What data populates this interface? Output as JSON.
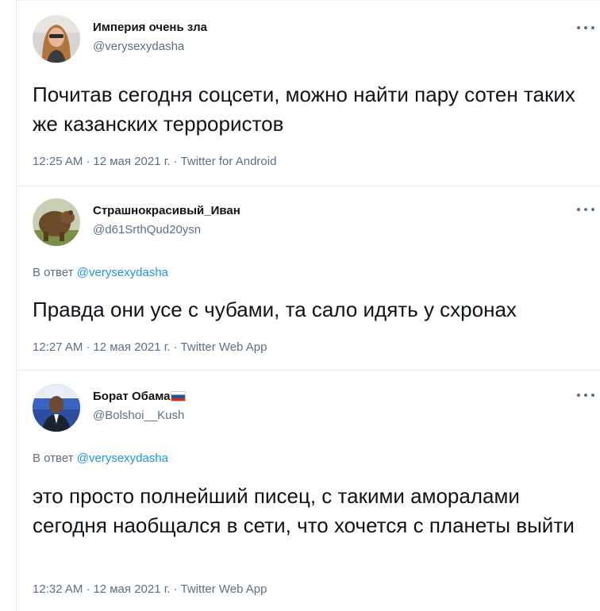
{
  "tweets": [
    {
      "display_name": "Империя очень зла",
      "handle": "@verysexydasha",
      "reply_to_prefix": "",
      "reply_to_handle": "",
      "text": "Почитав сегодня соцсети, можно найти пару сотен таких же казанских террористов",
      "time": "12:25 AM",
      "date": "12 мая 2021 г.",
      "source": "Twitter for Android",
      "has_flag": false
    },
    {
      "display_name": "Страшнокрасивый_Иван",
      "handle": "@d61SrthQud20ysn",
      "reply_to_prefix": "В ответ",
      "reply_to_handle": "@verysexydasha",
      "text": "Правда они усе с чубами, та сало идять у схронах",
      "time": "12:27 AM",
      "date": "12 мая 2021 г.",
      "source": "Twitter Web App",
      "has_flag": false
    },
    {
      "display_name": "Борат Обама",
      "handle": "@Bolshoi__Kush",
      "reply_to_prefix": "В ответ",
      "reply_to_handle": "@verysexydasha",
      "text": "это просто полнейший писец, с такими аморалами сегодня наобщался в сети, что хочется с планеты выйти",
      "time": "12:32 AM",
      "date": "12 мая 2021 г.",
      "source": "Twitter Web App",
      "has_flag": true
    }
  ],
  "meta_separator": "·",
  "icons": {
    "more": "more-horizontal-icon",
    "flag": "russian-flag-icon"
  },
  "colors": {
    "text": "#0f1419",
    "secondary": "#5b7083",
    "link": "#1b95e0",
    "divider": "#e6ecf0"
  }
}
